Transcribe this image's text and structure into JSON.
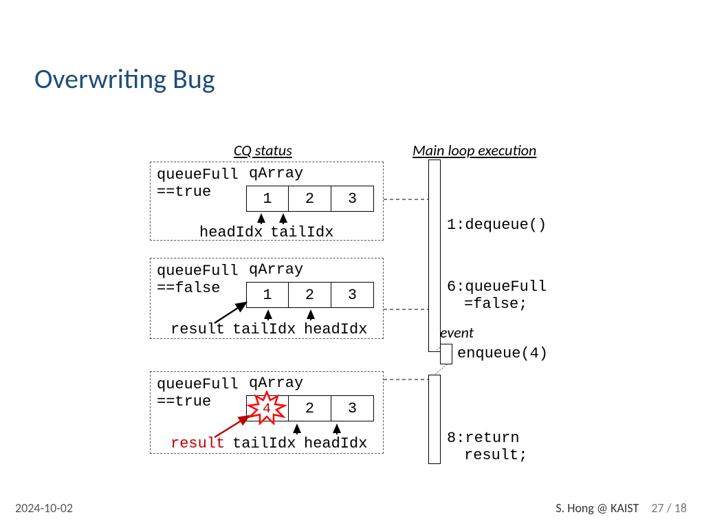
{
  "title": "Overwriting Bug",
  "headers": {
    "cq": "CQ status",
    "main": "Main loop  execution"
  },
  "boxes": [
    {
      "qf": "queueFull\n==true",
      "arrLabel": "qArray",
      "cells": [
        "1",
        "2",
        "3"
      ],
      "ptrs": {
        "head": "headIdx",
        "tail": "tailIdx"
      }
    },
    {
      "qf": "queueFull\n==false",
      "arrLabel": "qArray",
      "cells": [
        "1",
        "2",
        "3"
      ],
      "ptrs": {
        "tail": "tailIdx",
        "head": "headIdx"
      },
      "result": "result"
    },
    {
      "qf": "queueFull\n==true",
      "arrLabel": "qArray",
      "cells": [
        "4",
        "2",
        "3"
      ],
      "ptrs": {
        "tail": "tailIdx",
        "head": "headIdx"
      },
      "result": "result"
    }
  ],
  "exec": {
    "step1": "1:dequeue()",
    "step6a": "6:queueFull",
    "step6b": "=false;",
    "event": "event",
    "enq": "enqueue(4)",
    "step8a": "8:return",
    "step8b": "result;"
  },
  "footer": {
    "date": "2024-10-02",
    "author": "S. Hong @ KAIST",
    "page": "27 / 18"
  }
}
